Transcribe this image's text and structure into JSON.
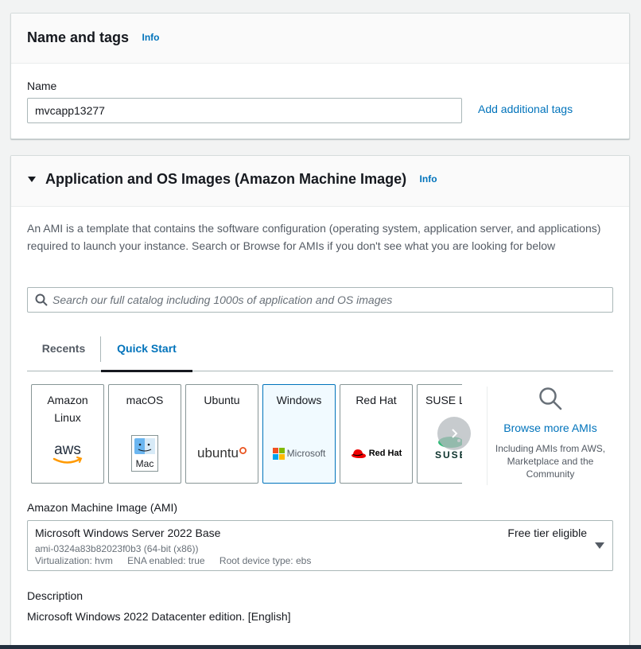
{
  "name_tags": {
    "title": "Name and tags",
    "info": "Info",
    "name_label": "Name",
    "name_value": "mvcapp13277",
    "add_tags": "Add additional tags"
  },
  "ami_section": {
    "title": "Application and OS Images (Amazon Machine Image)",
    "info": "Info",
    "description": "An AMI is a template that contains the software configuration (operating system, application server, and applications) required to launch your instance. Search or Browse for AMIs if you don't see what you are looking for below",
    "search_placeholder": "Search our full catalog including 1000s of application and OS images",
    "tabs": [
      "Recents",
      "Quick Start"
    ],
    "active_tab": "Quick Start",
    "tiles": [
      {
        "label": "Amazon Linux",
        "logo": "aws",
        "selected": false
      },
      {
        "label": "macOS",
        "logo": "Mac",
        "selected": false
      },
      {
        "label": "Ubuntu",
        "logo": "ubuntu",
        "selected": false
      },
      {
        "label": "Windows",
        "logo": "Microsoft",
        "selected": true
      },
      {
        "label": "Red Hat",
        "logo": "Red Hat",
        "selected": false
      },
      {
        "label": "SUSE Linux",
        "logo": "SUSE",
        "selected": false
      }
    ],
    "browse": {
      "title": "Browse more AMIs",
      "subtitle": "Including AMIs from AWS, Marketplace and the Community"
    },
    "ami_label": "Amazon Machine Image (AMI)",
    "ami": {
      "name": "Microsoft Windows Server 2022 Base",
      "id": "ami-0324a83b82023f0b3 (64-bit (x86))",
      "virtualization": "Virtualization: hvm",
      "ena": "ENA enabled: true",
      "root_device": "Root device type: ebs",
      "badge": "Free tier eligible"
    },
    "desc_label": "Description",
    "desc_value": "Microsoft Windows 2022 Datacenter edition. [English]"
  },
  "colors": {
    "link": "#0073bb",
    "selected_tile_bg": "#f1faff",
    "aws_orange": "#ff9900",
    "ubuntu_orange": "#e95420",
    "redhat_red": "#ee0000",
    "suse_green": "#30ba78"
  }
}
